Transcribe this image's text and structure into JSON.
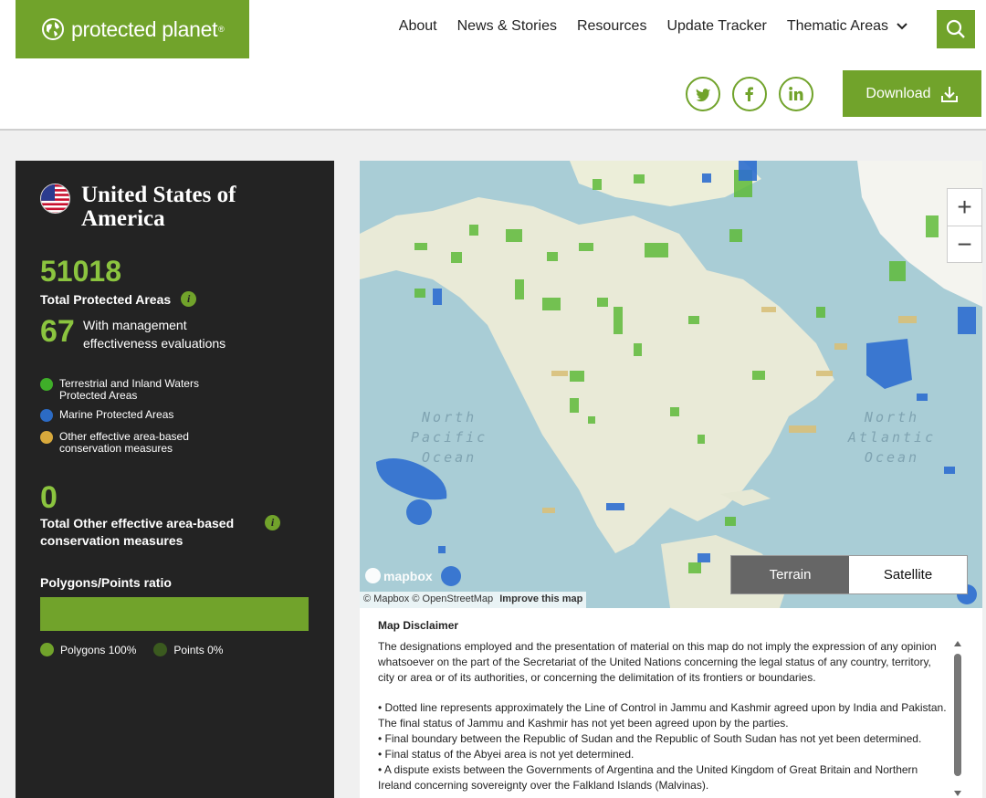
{
  "header": {
    "logo_text": "protected planet",
    "logo_mark": "®",
    "nav": [
      "About",
      "News & Stories",
      "Resources",
      "Update Tracker",
      "Thematic Areas"
    ],
    "download_label": "Download",
    "social": [
      "twitter-icon",
      "facebook-icon",
      "linkedin-icon"
    ],
    "brand_color": "#71a32b"
  },
  "sidebar": {
    "country": "United States of America",
    "total_pa": "51018",
    "total_pa_label": "Total Protected Areas",
    "me_count": "67",
    "me_label": "With management effectiveness evaluations",
    "legend": [
      {
        "label": "Terrestrial and Inland Waters Protected Areas",
        "color": "#3fae29"
      },
      {
        "label": "Marine Protected Areas",
        "color": "#2c6bc4"
      },
      {
        "label": "Other effective area-based conservation measures",
        "color": "#d8a93c"
      }
    ],
    "oecm_total": "0",
    "oecm_label": "Total Other effective area-based conservation measures",
    "ratio_title": "Polygons/Points ratio",
    "polygons_fraction": 1.0,
    "polygons_label": "Polygons 100%",
    "points_label": "Points 0%",
    "polygon_color": "#71a32b",
    "points_color": "#3b5a1f"
  },
  "map": {
    "ocean_labels": [
      "North Pacific Ocean",
      "North Atlantic Ocean"
    ],
    "mapbox_label": "mapbox",
    "attribution": "© Mapbox © OpenStreetMap",
    "improve_label": "Improve this map",
    "zoom_in": "+",
    "zoom_out": "−",
    "terrain_label": "Terrain",
    "satellite_label": "Satellite"
  },
  "disclaimer": {
    "title": "Map Disclaimer",
    "paragraph": "The designations employed and the presentation of material on this map do not imply the expression of any opinion whatsoever on the part of the Secretariat of the United Nations concerning the legal status of any country, territory, city or area or of its authorities, or concerning the delimitation of its frontiers or boundaries.",
    "bullets": [
      "• Dotted line represents approximately the Line of Control in Jammu and Kashmir agreed upon by India and Pakistan. The final status of Jammu and Kashmir has not yet been agreed upon by the parties.",
      "• Final boundary between the Republic of Sudan and the Republic of South Sudan has not yet been determined.",
      "• Final status of the Abyei area is not yet determined.",
      "• A dispute exists between the Governments of Argentina and the United Kingdom of Great Britain and Northern Ireland concerning sovereignty over the Falkland Islands (Malvinas)."
    ]
  }
}
